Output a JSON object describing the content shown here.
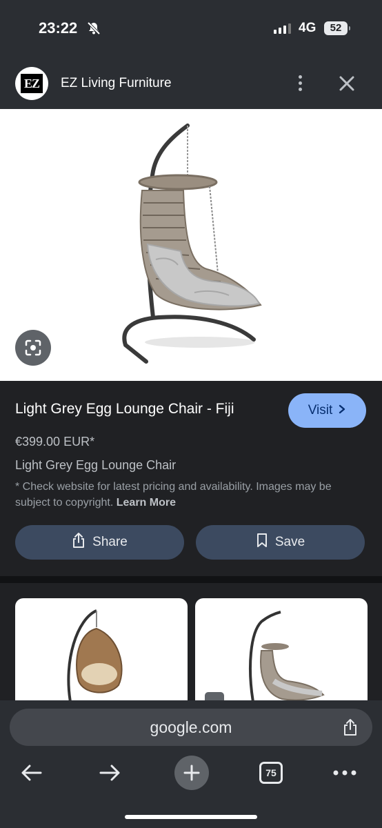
{
  "status_bar": {
    "time": "23:22",
    "network": "4G",
    "battery": "52"
  },
  "header": {
    "logo_text": "EZ",
    "site_name": "EZ Living Furniture"
  },
  "product": {
    "title": "Light Grey Egg Lounge Chair - Fiji",
    "visit_label": "Visit",
    "price": "€399.00 EUR*",
    "subtitle": "Light Grey Egg Lounge Chair",
    "disclaimer": "* Check website for latest pricing and availability. Images may be subject to copyright.",
    "learn_more": "Learn More",
    "share_label": "Share",
    "save_label": "Save"
  },
  "browser": {
    "url": "google.com",
    "tab_count": "75"
  },
  "colors": {
    "accent": "#8ab4f8",
    "button_bg": "#3c4a60",
    "background": "#202124"
  },
  "icons": [
    "bell-off-icon",
    "signal-icon",
    "battery-icon",
    "more-vertical-icon",
    "close-icon",
    "lens-icon",
    "chevron-right-icon",
    "share-icon",
    "bookmark-icon",
    "back-arrow-icon",
    "forward-arrow-icon",
    "plus-icon",
    "tabs-icon",
    "more-horizontal-icon"
  ]
}
